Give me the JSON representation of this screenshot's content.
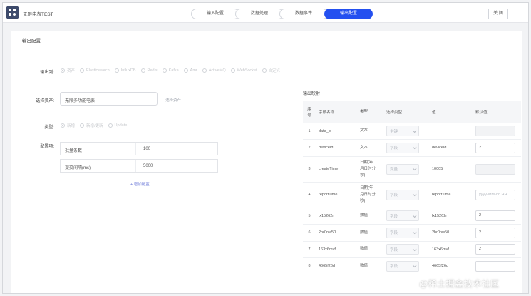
{
  "header": {
    "app_title": "无限电表TEST",
    "tabs": [
      {
        "label": "输入配置",
        "active": false
      },
      {
        "label": "数据处理",
        "active": false
      },
      {
        "label": "数据事件",
        "active": false
      },
      {
        "label": "输出配置",
        "active": true
      }
    ],
    "close_label": "关 闭"
  },
  "panel": {
    "title": "输出配置",
    "output_to": {
      "label": "输出到:",
      "options": [
        {
          "label": "资产",
          "checked": true
        },
        {
          "label": "Elasticsearch",
          "checked": false
        },
        {
          "label": "InfluxDB",
          "checked": false
        },
        {
          "label": "Redis",
          "checked": false
        },
        {
          "label": "Kafka",
          "checked": false
        },
        {
          "label": "Amr",
          "checked": false
        },
        {
          "label": "ActiveMQ",
          "checked": false
        },
        {
          "label": "WebSocket",
          "checked": false
        },
        {
          "label": "自定义",
          "checked": false
        }
      ]
    },
    "asset": {
      "label": "选择资产:",
      "value": "无限多功能电表",
      "link": "选择资产"
    },
    "type": {
      "label": "类型:",
      "options": [
        {
          "label": "新增",
          "checked": true
        },
        {
          "label": "新增/更新",
          "checked": false
        },
        {
          "label": "Update",
          "checked": false
        }
      ]
    },
    "config": {
      "label": "配置项:",
      "rows": [
        {
          "key": "批量条数",
          "value": "100"
        },
        {
          "key": "提交间隔(ms)",
          "value": "5000"
        }
      ],
      "add_label": "+ 增加配置"
    }
  },
  "mapping": {
    "title": "输出映射",
    "headers": [
      "序号",
      "字段名称",
      "类型",
      "选择类型",
      "值",
      "默认值"
    ],
    "rows": [
      {
        "idx": "1",
        "name": "data_id",
        "type": [
          "文本"
        ],
        "select": "主键",
        "value": "",
        "default": "",
        "default_state": "disabled",
        "tall": false
      },
      {
        "idx": "2",
        "name": "deviceId",
        "type": [
          "文本"
        ],
        "select": "字段",
        "value": "deviceId",
        "default": "2",
        "default_state": "normal",
        "tall": false
      },
      {
        "idx": "3",
        "name": "createTime",
        "type": [
          "日期(年",
          "月日时分",
          "秒)"
        ],
        "select": "变量",
        "value": "10005",
        "default": "",
        "default_state": "disabled",
        "tall": true
      },
      {
        "idx": "4",
        "name": "reportTime",
        "type": [
          "日期(年",
          "月日时分",
          "秒)"
        ],
        "select": "字段",
        "value": "reportTime",
        "default": "yyyy-MM-dd HH...",
        "default_state": "placeholder",
        "tall": true
      },
      {
        "idx": "5",
        "name": "lx15262r",
        "type": [
          "数值"
        ],
        "select": "字段",
        "value": "lx15262r",
        "default": "2",
        "default_state": "normal",
        "tall": false
      },
      {
        "idx": "6",
        "name": "2hr0nw50",
        "type": [
          "数值"
        ],
        "select": "字段",
        "value": "2hr0nw50",
        "default": "2",
        "default_state": "normal",
        "tall": false
      },
      {
        "idx": "7",
        "name": "163x6mvf",
        "type": [
          "数值"
        ],
        "select": "字段",
        "value": "163x6mvf",
        "default": "2",
        "default_state": "normal",
        "tall": false
      },
      {
        "idx": "8",
        "name": "4665f26d",
        "type": [
          "数值"
        ],
        "select": "字段",
        "value": "4665f26d",
        "default": "",
        "default_state": "normal",
        "tall": false
      }
    ]
  },
  "watermark": "@稀土掘金技术社区"
}
